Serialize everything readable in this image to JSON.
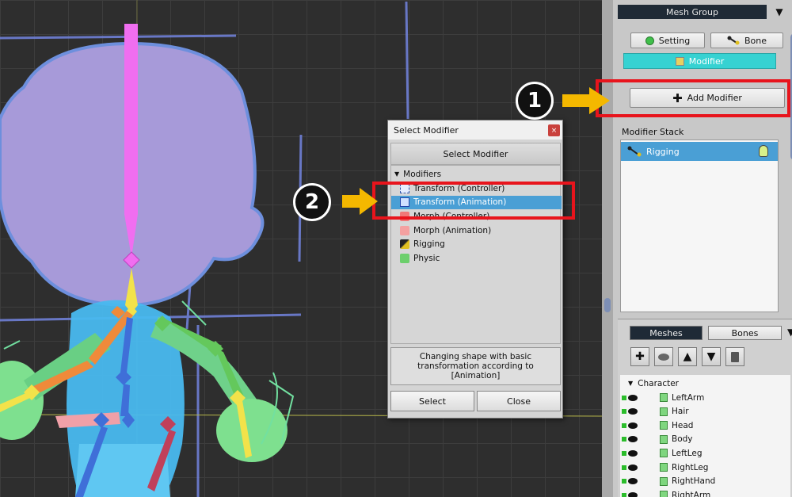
{
  "panel": {
    "mesh_group": "Mesh Group",
    "setting_label": "Setting",
    "bone_label": "Bone",
    "modifier_label": "Modifier",
    "add_modifier_label": "Add Modifier",
    "modifier_stack_label": "Modifier Stack",
    "stack_items": [
      {
        "label": "Rigging"
      }
    ],
    "meshes_tab": "Meshes",
    "bones_tab": "Bones",
    "hierarchy_root": "Character",
    "hierarchy_items": [
      "LeftArm",
      "Hair",
      "Head",
      "Body",
      "LeftLeg",
      "RightLeg",
      "RightHand",
      "RightArm"
    ]
  },
  "dialog": {
    "title": "Select Modifier",
    "close_glyph": "×",
    "header": "Select Modifier",
    "group_label": "Modifiers",
    "items": [
      {
        "label": "Transform (Controller)",
        "icon": "transform-controller-icon"
      },
      {
        "label": "Transform (Animation)",
        "icon": "transform-animation-icon"
      },
      {
        "label": "Morph (Controller)",
        "icon": "morph-controller-icon"
      },
      {
        "label": "Morph (Animation)",
        "icon": "morph-animation-icon"
      },
      {
        "label": "Rigging",
        "icon": "rigging-icon"
      },
      {
        "label": "Physic",
        "icon": "physic-icon"
      }
    ],
    "selected_item": "Transform (Animation)",
    "description": "Changing shape with basic transformation according to [Animation]",
    "select_button": "Select",
    "close_button": "Close"
  },
  "callouts": [
    {
      "number": "1"
    },
    {
      "number": "2"
    }
  ],
  "colors": {
    "accent_blue": "#4a9fd5",
    "modifier_tab": "#36d2d2",
    "highlight_red": "#e8141c",
    "arrow_yellow": "#f4b800"
  }
}
